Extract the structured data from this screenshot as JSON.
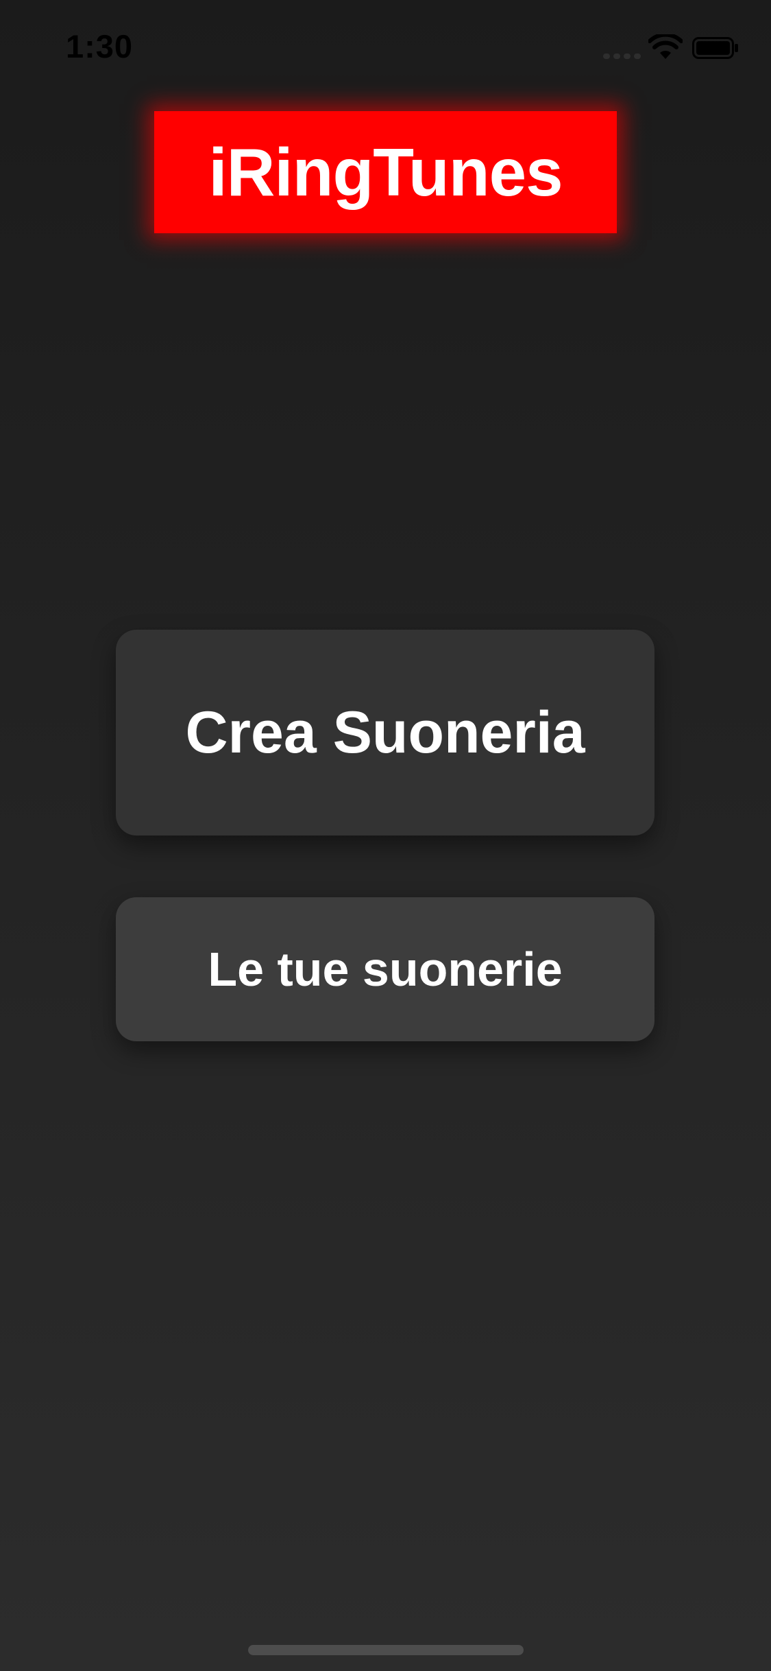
{
  "status_bar": {
    "time": "1:30",
    "icons": [
      "signal-icon",
      "wifi-icon",
      "battery-icon"
    ]
  },
  "app": {
    "logo_text": "iRingTunes",
    "logo_color": "#ff0000"
  },
  "menu": {
    "create_label": "Crea Suoneria",
    "list_label": "Le tue suonerie"
  },
  "colors": {
    "background": "#222222",
    "button_primary": "#333333",
    "button_secondary": "#3d3d3d",
    "text": "#ffffff"
  }
}
